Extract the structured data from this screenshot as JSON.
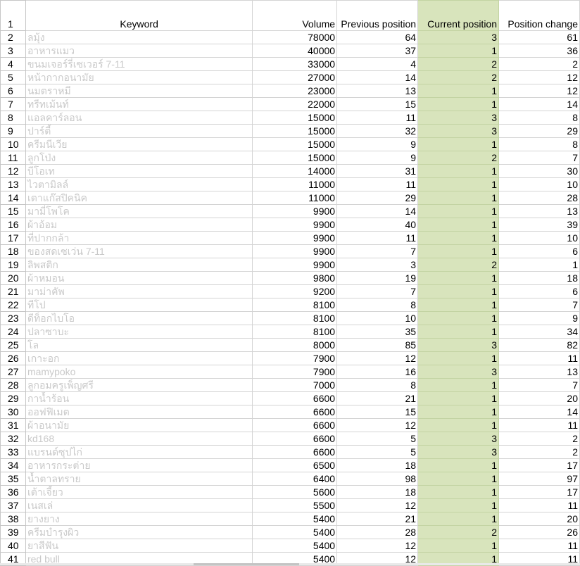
{
  "header": {
    "row_number": "1",
    "keyword": "Keyword",
    "volume": "Volume",
    "previous": "Previous position",
    "current": "Current position",
    "change": "Position change"
  },
  "rows": [
    {
      "n": "2",
      "kw": "ลมุ้ง",
      "vol": "78000",
      "prev": "64",
      "cur": "3",
      "chg": "61"
    },
    {
      "n": "3",
      "kw": "อาหารแมว",
      "vol": "40000",
      "prev": "37",
      "cur": "1",
      "chg": "36"
    },
    {
      "n": "4",
      "kw": "ขนมเจอร์รี่เซเวอร์ 7-11",
      "vol": "33000",
      "prev": "4",
      "cur": "2",
      "chg": "2"
    },
    {
      "n": "5",
      "kw": "หน้ากากอนามัย",
      "vol": "27000",
      "prev": "14",
      "cur": "2",
      "chg": "12"
    },
    {
      "n": "6",
      "kw": "นมตราหมี",
      "vol": "23000",
      "prev": "13",
      "cur": "1",
      "chg": "12"
    },
    {
      "n": "7",
      "kw": "ทรีทเม้นท์",
      "vol": "22000",
      "prev": "15",
      "cur": "1",
      "chg": "14"
    },
    {
      "n": "8",
      "kw": "แอลคาร์ลอน",
      "vol": "15000",
      "prev": "11",
      "cur": "3",
      "chg": "8"
    },
    {
      "n": "9",
      "kw": "ปาร์ตี้",
      "vol": "15000",
      "prev": "32",
      "cur": "3",
      "chg": "29"
    },
    {
      "n": "10",
      "kw": "ครีมนีเวีย",
      "vol": "15000",
      "prev": "9",
      "cur": "1",
      "chg": "8"
    },
    {
      "n": "11",
      "kw": "ลูกโป่ง",
      "vol": "15000",
      "prev": "9",
      "cur": "2",
      "chg": "7"
    },
    {
      "n": "12",
      "kw": "บีโอเท",
      "vol": "14000",
      "prev": "31",
      "cur": "1",
      "chg": "30"
    },
    {
      "n": "13",
      "kw": "ไวตามิลล์",
      "vol": "11000",
      "prev": "11",
      "cur": "1",
      "chg": "10"
    },
    {
      "n": "14",
      "kw": "เตาแก๊สปิคนิค",
      "vol": "11000",
      "prev": "29",
      "cur": "1",
      "chg": "28"
    },
    {
      "n": "15",
      "kw": "มามี่โพโค",
      "vol": "9900",
      "prev": "14",
      "cur": "1",
      "chg": "13"
    },
    {
      "n": "16",
      "kw": "ผ้าอ้อม",
      "vol": "9900",
      "prev": "40",
      "cur": "1",
      "chg": "39"
    },
    {
      "n": "17",
      "kw": "ที่ปากกล้า",
      "vol": "9900",
      "prev": "11",
      "cur": "1",
      "chg": "10"
    },
    {
      "n": "18",
      "kw": "ของสดเซเว่น 7-11",
      "vol": "9900",
      "prev": "7",
      "cur": "1",
      "chg": "6"
    },
    {
      "n": "19",
      "kw": "ลิพสติก",
      "vol": "9900",
      "prev": "3",
      "cur": "2",
      "chg": "1"
    },
    {
      "n": "20",
      "kw": "ผ้าหมอน",
      "vol": "9800",
      "prev": "19",
      "cur": "1",
      "chg": "18"
    },
    {
      "n": "21",
      "kw": "มาม่าคัพ",
      "vol": "9200",
      "prev": "7",
      "cur": "1",
      "chg": "6"
    },
    {
      "n": "22",
      "kw": "ทีโป",
      "vol": "8100",
      "prev": "8",
      "cur": "1",
      "chg": "7"
    },
    {
      "n": "23",
      "kw": "ดีท็อกไบโอ",
      "vol": "8100",
      "prev": "10",
      "cur": "1",
      "chg": "9"
    },
    {
      "n": "24",
      "kw": "ปลาซาบะ",
      "vol": "8100",
      "prev": "35",
      "cur": "1",
      "chg": "34"
    },
    {
      "n": "25",
      "kw": "โล",
      "vol": "8000",
      "prev": "85",
      "cur": "3",
      "chg": "82"
    },
    {
      "n": "26",
      "kw": "เกาะอก",
      "vol": "7900",
      "prev": "12",
      "cur": "1",
      "chg": "11"
    },
    {
      "n": "27",
      "kw": "mamypoko",
      "vol": "7900",
      "prev": "16",
      "cur": "3",
      "chg": "13"
    },
    {
      "n": "28",
      "kw": "ลูกอมครูเพ็ญศรี",
      "vol": "7000",
      "prev": "8",
      "cur": "1",
      "chg": "7"
    },
    {
      "n": "29",
      "kw": "กาน้ำร้อน",
      "vol": "6600",
      "prev": "21",
      "cur": "1",
      "chg": "20"
    },
    {
      "n": "30",
      "kw": "ออฟฟิเมต",
      "vol": "6600",
      "prev": "15",
      "cur": "1",
      "chg": "14"
    },
    {
      "n": "31",
      "kw": "ผ้าอนามัย",
      "vol": "6600",
      "prev": "12",
      "cur": "1",
      "chg": "11"
    },
    {
      "n": "32",
      "kw": "kd168",
      "vol": "6600",
      "prev": "5",
      "cur": "3",
      "chg": "2"
    },
    {
      "n": "33",
      "kw": "แบรนด์ซุปไก่",
      "vol": "6600",
      "prev": "5",
      "cur": "3",
      "chg": "2"
    },
    {
      "n": "34",
      "kw": "อาหารกระต่าย",
      "vol": "6500",
      "prev": "18",
      "cur": "1",
      "chg": "17"
    },
    {
      "n": "35",
      "kw": "น้ำตาลทราย",
      "vol": "6400",
      "prev": "98",
      "cur": "1",
      "chg": "97"
    },
    {
      "n": "36",
      "kw": "เต้าเจี้ยว",
      "vol": "5600",
      "prev": "18",
      "cur": "1",
      "chg": "17"
    },
    {
      "n": "37",
      "kw": "เนสเล่",
      "vol": "5500",
      "prev": "12",
      "cur": "1",
      "chg": "11"
    },
    {
      "n": "38",
      "kw": "ยางยาง",
      "vol": "5400",
      "prev": "21",
      "cur": "1",
      "chg": "20"
    },
    {
      "n": "39",
      "kw": "ครีมบำรุงผิว",
      "vol": "5400",
      "prev": "28",
      "cur": "2",
      "chg": "26"
    },
    {
      "n": "40",
      "kw": "ยาสีฟัน",
      "vol": "5400",
      "prev": "12",
      "cur": "1",
      "chg": "11"
    },
    {
      "n": "41",
      "kw": "red bull",
      "vol": "5400",
      "prev": "12",
      "cur": "1",
      "chg": "11"
    }
  ],
  "colors": {
    "current_column_fill": "#d8e4bc",
    "gridline": "#d4d4d4",
    "faded_keyword_text": "#c9c9c9"
  }
}
